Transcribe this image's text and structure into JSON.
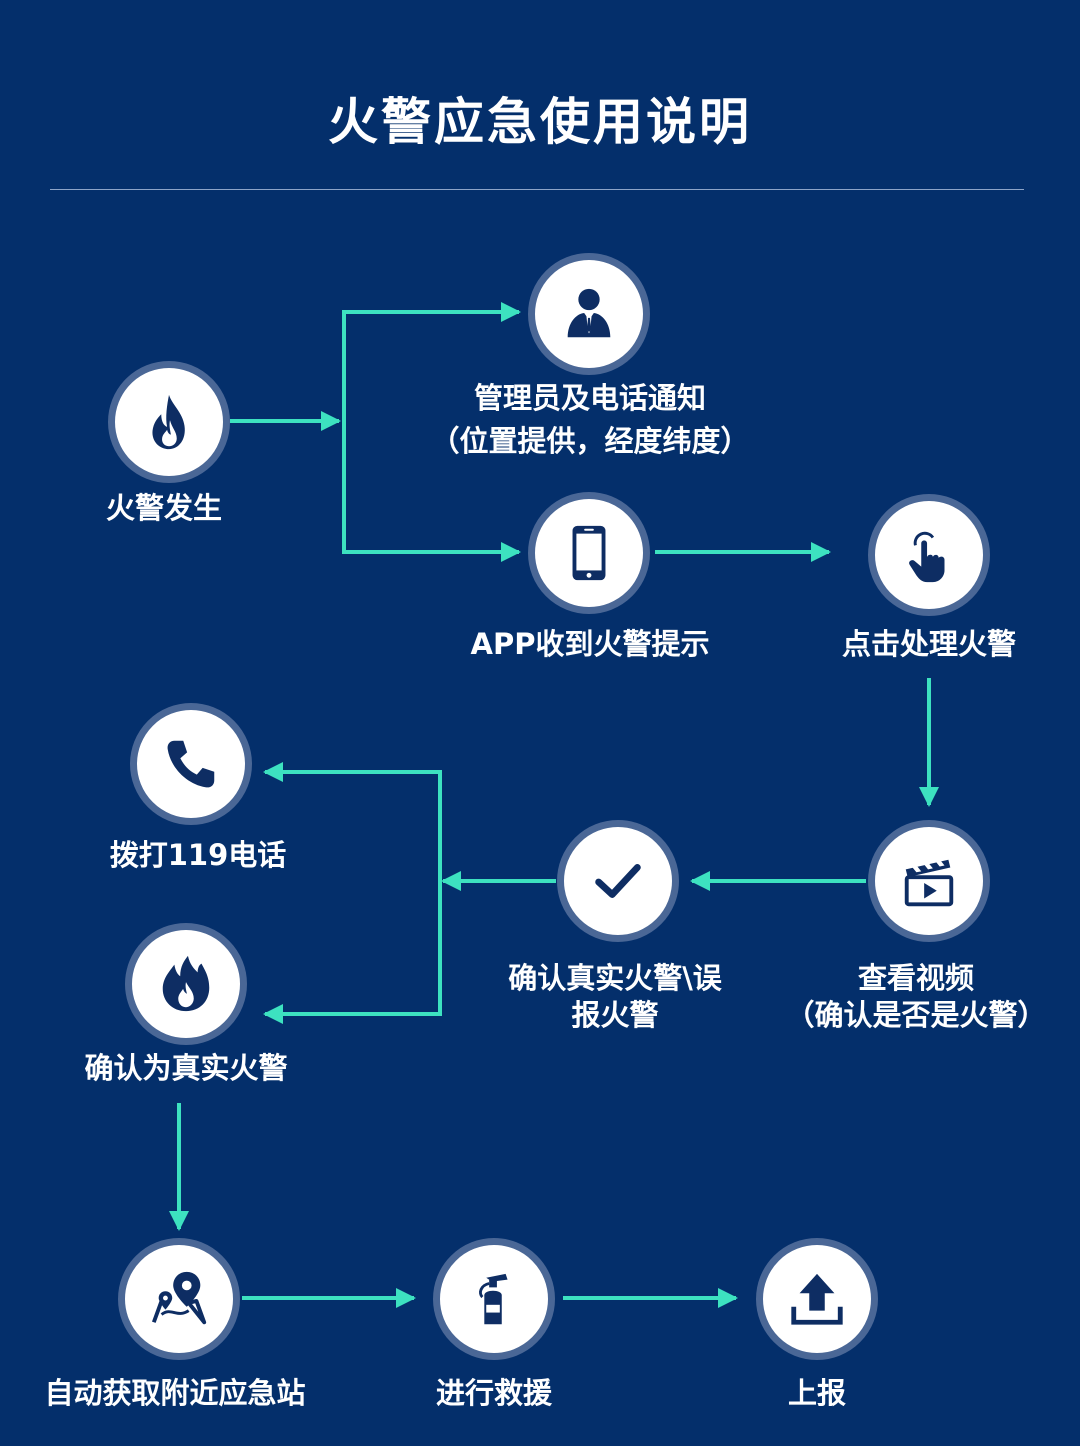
{
  "title": "火警应急使用说明",
  "colors": {
    "background": "#042f6b",
    "arrow": "#3de2c0",
    "icon": "#0e2d63",
    "node_ring": "#4a6796"
  },
  "nodes": {
    "fire": {
      "label": "火警发生",
      "icon": "flame-icon"
    },
    "manager": {
      "label_line1": "管理员及电话通知",
      "label_line2": "（位置提供，经度纬度）",
      "icon": "person-in-suit-icon"
    },
    "app": {
      "label": "APP收到火警提示",
      "icon": "smartphone-icon"
    },
    "click": {
      "label": "点击处理火警",
      "icon": "tap-hand-icon"
    },
    "video": {
      "label_line1": "查看视频",
      "label_line2": "（确认是否是火警）",
      "icon": "video-clapper-icon"
    },
    "confirm": {
      "label_line1": "确认真实火警\\误",
      "label_line2": "报火警",
      "icon": "checkmark-icon"
    },
    "call": {
      "label": "拨打119电话",
      "icon": "phone-icon"
    },
    "real": {
      "label": "确认为真实火警",
      "icon": "flame-icon"
    },
    "station": {
      "label": "自动获取附近应急站",
      "icon": "map-pin-icon"
    },
    "rescue": {
      "label": "进行救援",
      "icon": "fire-extinguisher-icon"
    },
    "report": {
      "label": "上报",
      "icon": "upload-icon"
    }
  }
}
